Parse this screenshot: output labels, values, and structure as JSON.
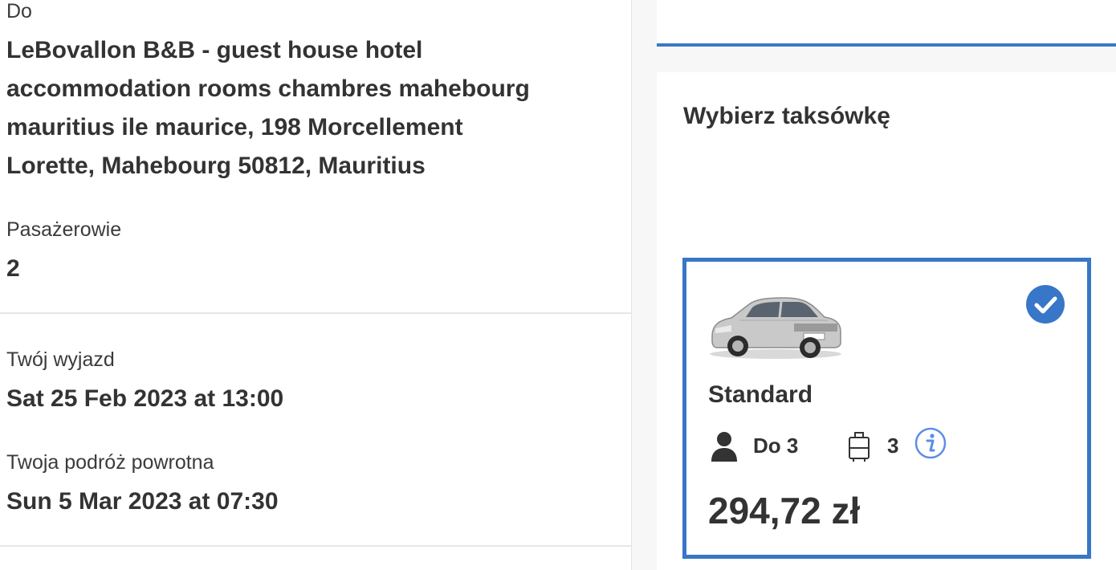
{
  "trip": {
    "to_label": "Do",
    "to_lines": [
      "LeBovallon B&B - guest house hotel",
      "accommodation rooms chambres mahebourg",
      "mauritius ile maurice, 198 Morcellement",
      "Lorette, Mahebourg 50812, Mauritius"
    ],
    "passengers_label": "Pasażerowie",
    "passengers_value": "2",
    "departure_label": "Twój wyjazd",
    "departure_value": "Sat 25 Feb 2023 at 13:00",
    "return_label": "Twoja podróż powrotna",
    "return_value": "Sun 5 Mar 2023 at 07:30"
  },
  "taxi": {
    "title": "Wybierz taksówkę",
    "option": {
      "name": "Standard",
      "passengers": "Do 3",
      "luggage": "3",
      "price": "294,72 zł",
      "selected": true
    }
  },
  "colors": {
    "accent": "#3876c8",
    "info": "#5b8de6"
  },
  "icons": [
    "car-image",
    "check-circle-icon",
    "person-icon",
    "luggage-icon",
    "info-icon"
  ]
}
